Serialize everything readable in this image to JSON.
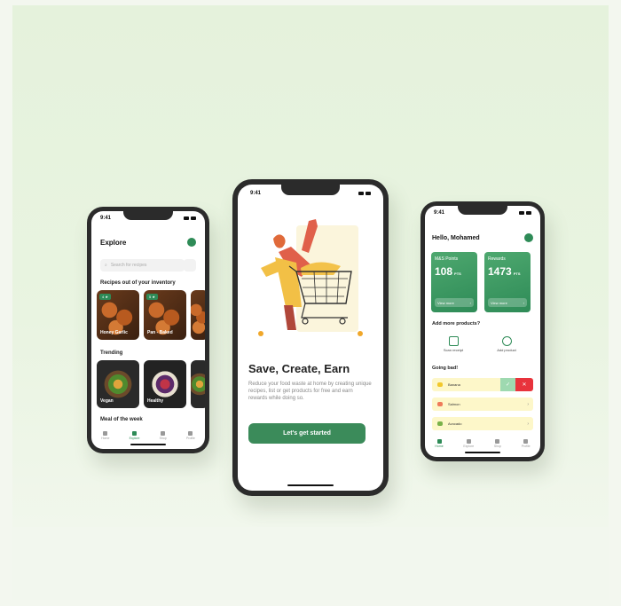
{
  "colors": {
    "accent": "#2e8b57",
    "background": "#e6f2de",
    "danger": "#e8333c",
    "warning_row": "#fdf7c9"
  },
  "status_time": "9:41",
  "left_phone": {
    "title": "Explore",
    "search_placeholder": "Search for recipes",
    "section_inventory": "Recipes out of your inventory",
    "cards": [
      {
        "tag": "4 ★",
        "label": "Honey Garlic"
      },
      {
        "tag": "5 ★",
        "label": "Pan - Baked"
      }
    ],
    "section_trending": "Trending",
    "trending": [
      "Vegan",
      "Healthy"
    ],
    "section_meal": "Meal of the week",
    "nav": [
      "Home",
      "Explore",
      "Shop",
      "Profile"
    ]
  },
  "center_phone": {
    "title": "Save, Create, Earn",
    "description": "Reduce your food waste at home by creating unique recipes, list or get products for free and earn rewards while doing so.",
    "cta": "Let's get started"
  },
  "right_phone": {
    "greeting": "Hello, Mohamed",
    "cards": [
      {
        "name": "M&S Points",
        "value": "108",
        "unit": "PTS",
        "link": "View more"
      },
      {
        "name": "Rewards",
        "value": "1473",
        "unit": "PTS",
        "link": "View more"
      }
    ],
    "section_add": "Add more products?",
    "actions": [
      {
        "icon": "camera-icon",
        "label": "Scan receipt"
      },
      {
        "icon": "search-icon",
        "label": "Add product"
      }
    ],
    "section_bad": "Going bad!",
    "bad_items": [
      "Banana",
      "Salmon",
      "Avocado"
    ],
    "nav": [
      "Home",
      "Explore",
      "Shop",
      "Profile"
    ]
  }
}
